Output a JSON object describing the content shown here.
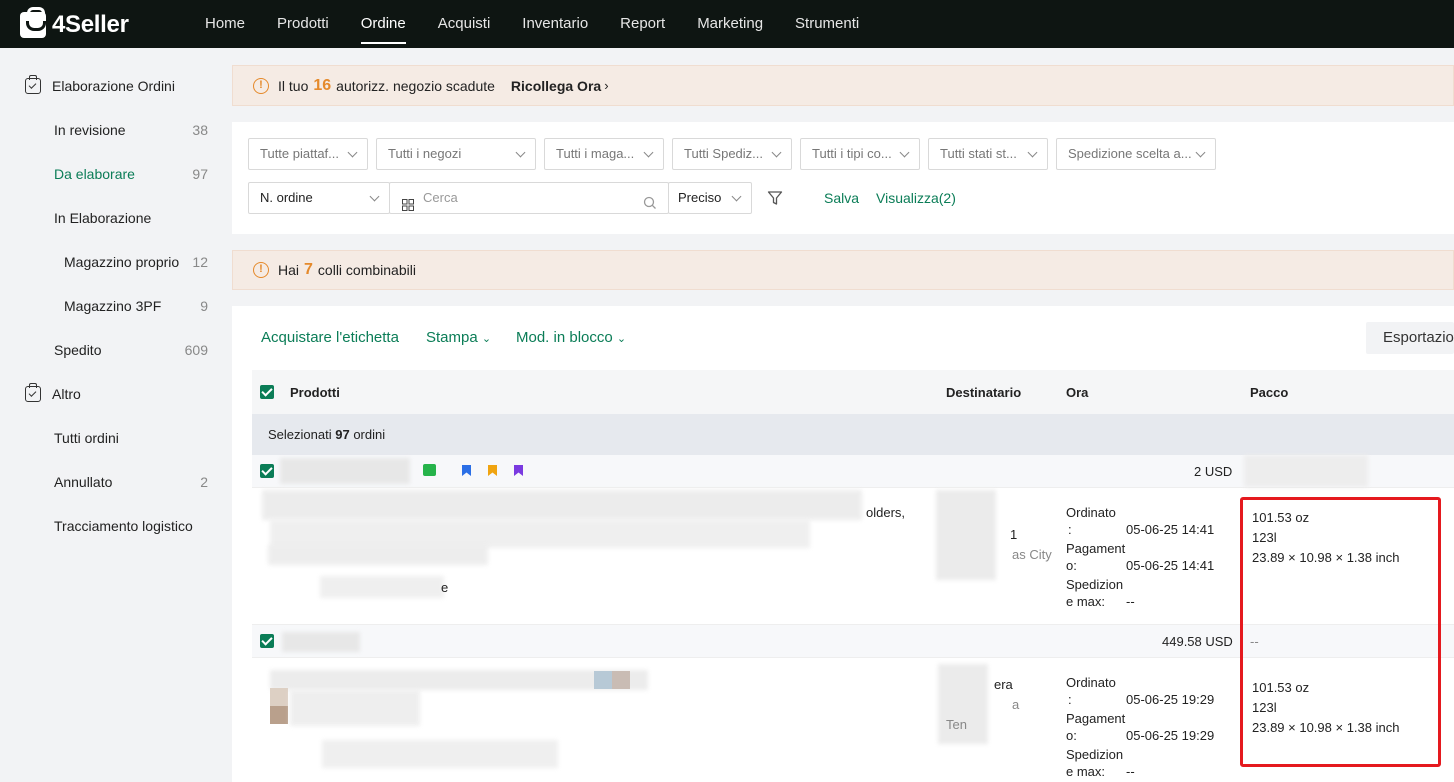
{
  "app": {
    "name": "4Seller"
  },
  "nav": {
    "items": [
      {
        "label": "Home"
      },
      {
        "label": "Prodotti"
      },
      {
        "label": "Ordine"
      },
      {
        "label": "Acquisti"
      },
      {
        "label": "Inventario"
      },
      {
        "label": "Report"
      },
      {
        "label": "Marketing"
      },
      {
        "label": "Strumenti"
      }
    ],
    "active": "Ordine"
  },
  "sidebar": {
    "group1": "Elaborazione Ordini",
    "in_revisione": {
      "label": "In revisione",
      "count": "38"
    },
    "da_elaborare": {
      "label": "Da elaborare",
      "count": "97"
    },
    "in_elaborazione": {
      "label": "In Elaborazione"
    },
    "magazzino_proprio": {
      "label": "Magazzino proprio",
      "count": "12"
    },
    "magazzino_3pf": {
      "label": "Magazzino 3PF",
      "count": "9"
    },
    "spedito": {
      "label": "Spedito",
      "count": "609"
    },
    "group2": "Altro",
    "tutti_ordini": {
      "label": "Tutti ordini"
    },
    "annullato": {
      "label": "Annullato",
      "count": "2"
    },
    "tracciamento": {
      "label": "Tracciamento logistico"
    }
  },
  "notice1": {
    "prefix": "Il tuo",
    "number": "16",
    "suffix": "autorizz. negozio scadute",
    "link": "Ricollega Ora"
  },
  "filters": {
    "platform": "Tutte piattaf...",
    "stores": "Tutti i negozi",
    "warehouse": "Tutti i maga...",
    "shipping": "Tutti Spediz...",
    "types": "Tutti i tipi co...",
    "status": "Tutti stati st...",
    "shipping_choice": "Spedizione scelta a...",
    "order_field": "N. ordine",
    "search_placeholder": "Cerca",
    "match": "Preciso",
    "save": "Salva",
    "view": "Visualizza(2)"
  },
  "notice2": {
    "prefix": "Hai",
    "number": "7",
    "suffix": "colli combinabili"
  },
  "toolbar": {
    "buy_label": "Acquistare l'etichetta",
    "print": "Stampa",
    "bulk": "Mod. in blocco",
    "export": "Esportazio"
  },
  "table": {
    "headers": {
      "products": "Prodotti",
      "recipient": "Destinatario",
      "time": "Ora",
      "package": "Pacco"
    },
    "selected_prefix": "Selezionati",
    "selected_count": "97",
    "selected_suffix": "ordini",
    "orders": [
      {
        "total": "2 USD",
        "package_header": "",
        "product_fragment": "olders,",
        "product_fragment2": "e",
        "recipient_fragment1": "1",
        "recipient_fragment2": "as City",
        "ordered_label": "Ordinato",
        "ordered_colon": ":",
        "ordered": "05-06-25 14:41",
        "paid_label": "Pagament",
        "paid_label2": "o:",
        "paid": "05-06-25 14:41",
        "ship_label": "Spedizion",
        "ship_label2": "e max:",
        "ship_max": "--",
        "weight": "101.53 oz",
        "code": "123l",
        "dimensions": "23.89 × 10.98 × 1.38 inch"
      },
      {
        "total": "449.58 USD",
        "package_header": "--",
        "recipient_fragment1": "era",
        "recipient_fragment2": "a",
        "recipient_fragment3": "Ten",
        "ordered_label": "Ordinato",
        "ordered_colon": ":",
        "ordered": "05-06-25 19:29",
        "paid_label": "Pagament",
        "paid_label2": "o:",
        "paid": "05-06-25 19:29",
        "ship_label": "Spedizion",
        "ship_label2": "e max:",
        "ship_max": "--",
        "weight": "101.53 oz",
        "code": "123l",
        "dimensions": "23.89 × 10.98 × 1.38 inch"
      }
    ]
  },
  "colors": {
    "accent": "#0b7d57",
    "warning": "#e58a2c",
    "highlight": "#e5191e",
    "topbar": "#0e1512"
  }
}
